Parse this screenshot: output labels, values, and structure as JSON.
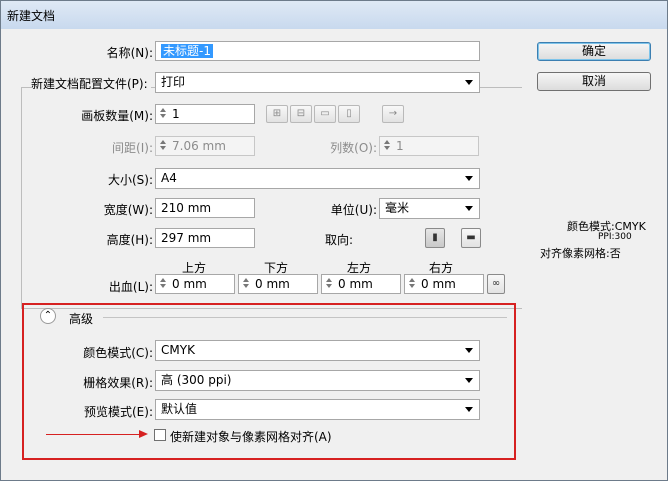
{
  "window": {
    "title": "新建文档"
  },
  "name": {
    "label": "名称(N):",
    "value": "未标题-1"
  },
  "profile": {
    "label": "新建文档配置文件(P):",
    "value": "打印"
  },
  "artboards": {
    "label": "画板数量(M):",
    "value": "1"
  },
  "spacing": {
    "label": "间距(I):",
    "value": "7.06 mm"
  },
  "columns": {
    "label": "列数(O):",
    "value": "1"
  },
  "size": {
    "label": "大小(S):",
    "value": "A4"
  },
  "width": {
    "label": "宽度(W):",
    "value": "210 mm"
  },
  "units": {
    "label": "单位(U):",
    "value": "毫米"
  },
  "height": {
    "label": "高度(H):",
    "value": "297 mm"
  },
  "orientation": {
    "label": "取向:"
  },
  "bleed": {
    "label": "出血(L):",
    "top_label": "上方",
    "bottom_label": "下方",
    "left_label": "左方",
    "right_label": "右方",
    "top": "0 mm",
    "bottom": "0 mm",
    "left": "0 mm",
    "right": "0 mm"
  },
  "advanced": {
    "label": "高级",
    "color_mode": {
      "label": "颜色模式(C):",
      "value": "CMYK"
    },
    "raster": {
      "label": "栅格效果(R):",
      "value": "高 (300 ppi)"
    },
    "preview": {
      "label": "预览模式(E):",
      "value": "默认值"
    },
    "align_pixel": {
      "label": "使新建对象与像素网格对齐(A)",
      "checked": false
    }
  },
  "buttons": {
    "ok": "确定",
    "cancel": "取消"
  },
  "summary": {
    "color_mode": "颜色模式:CMYK",
    "ppi": "PPI:300",
    "pixel_grid": "对齐像素网格:否"
  },
  "colors": {
    "highlight": "#d62121",
    "selection": "#3399ff"
  }
}
